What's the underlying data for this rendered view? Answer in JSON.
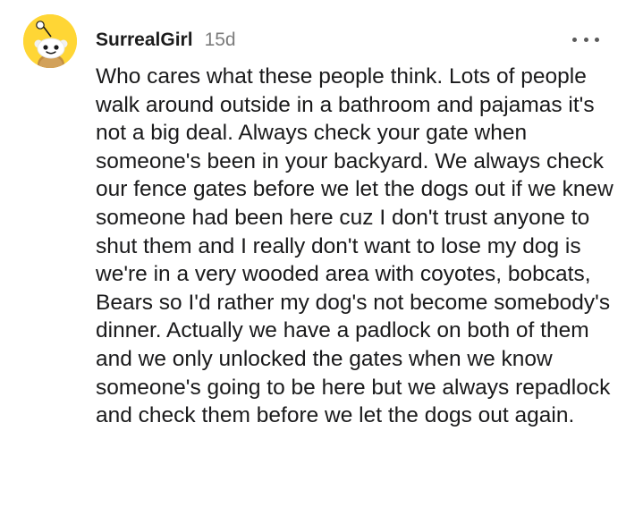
{
  "comment": {
    "username": "SurrealGirl",
    "timestamp": "15d",
    "avatar_icon": "reddit-snoo-avatar-icon",
    "avatar_color": "#ffd635",
    "more_icon": "more-options-icon",
    "body": "Who cares what these people think. Lots of people walk around outside in a bathroom and pajamas it's not a big deal. Always check your gate when someone's been in your backyard. We always check our fence gates before we let the dogs out if we knew someone had been here cuz I don't trust anyone to shut them and I really don't want to lose my dog is we're in a very wooded area with coyotes, bobcats, Bears so I'd rather my dog's not become somebody's dinner. Actually we have a padlock on both of them and we only unlocked the gates when we know someone's going to be here but we always repadlock and check them before we let the dogs out again."
  }
}
